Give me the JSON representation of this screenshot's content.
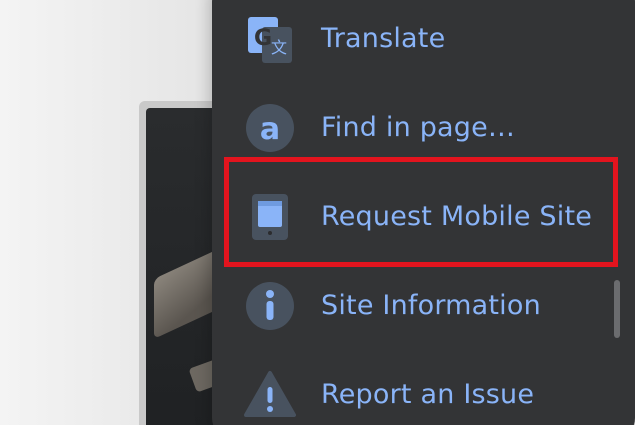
{
  "menu": {
    "items": [
      {
        "label": "Translate",
        "icon": "translate-icon"
      },
      {
        "label": "Find in page…",
        "icon": "find-in-page-icon"
      },
      {
        "label": "Request Mobile Site",
        "icon": "mobile-device-icon"
      },
      {
        "label": "Site Information",
        "icon": "info-icon"
      },
      {
        "label": "Report an Issue",
        "icon": "warning-icon"
      }
    ],
    "highlighted_item": "Request Mobile Site"
  },
  "colors": {
    "menu_background": "#333436",
    "label_color": "#8ab4f8",
    "icon_color": "#8ab4f8",
    "icon_badge": "#48525f",
    "highlight_border": "#e3141e"
  }
}
